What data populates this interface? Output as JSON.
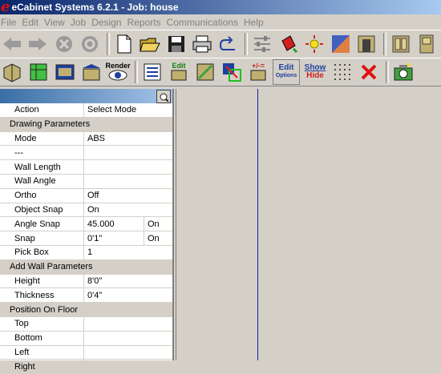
{
  "title": {
    "logo": "e",
    "text": "eCabinet Systems 6.2.1 - Job: house"
  },
  "menu": [
    "File",
    "Edit",
    "View",
    "Job",
    "Design",
    "Reports",
    "Communications",
    "Help"
  ],
  "toolbar2_text": {
    "render": "Render",
    "edit": "Edit",
    "plusminus": "+/-=",
    "edit_options_1": "Edit",
    "edit_options_2": "Options",
    "show": "Show",
    "hide": "Hide"
  },
  "panel": {
    "action": {
      "name": "Action",
      "value": "Select Mode"
    },
    "drawing_section": "Drawing Parameters",
    "mode": {
      "name": "Mode",
      "value": "ABS"
    },
    "dashes": {
      "name": "---",
      "value": ""
    },
    "wall_length": {
      "name": "Wall Length",
      "value": ""
    },
    "wall_angle": {
      "name": "Wall Angle",
      "value": ""
    },
    "ortho": {
      "name": "Ortho",
      "value": "Off"
    },
    "object_snap": {
      "name": "Object Snap",
      "value": "On"
    },
    "angle_snap": {
      "name": "Angle Snap",
      "value": "45.000",
      "ext": "On"
    },
    "snap": {
      "name": "Snap",
      "value": "0'1\"",
      "ext": "On"
    },
    "pick_box": {
      "name": "Pick Box",
      "value": "1"
    },
    "add_wall_section": "Add Wall Parameters",
    "height": {
      "name": "Height",
      "value": "8'0\""
    },
    "thickness": {
      "name": "Thickness",
      "value": "0'4\""
    },
    "floor_section": "Position On Floor",
    "top": {
      "name": "Top",
      "value": ""
    },
    "bottom": {
      "name": "Bottom",
      "value": ""
    },
    "left": {
      "name": "Left",
      "value": ""
    },
    "right": {
      "name": "Right",
      "value": ""
    }
  },
  "colors": {
    "accent_red": "#e01010",
    "title_blue": "#0a246a",
    "panel_header": "#3a6ea5",
    "canvas_line": "#1a1aa0"
  }
}
